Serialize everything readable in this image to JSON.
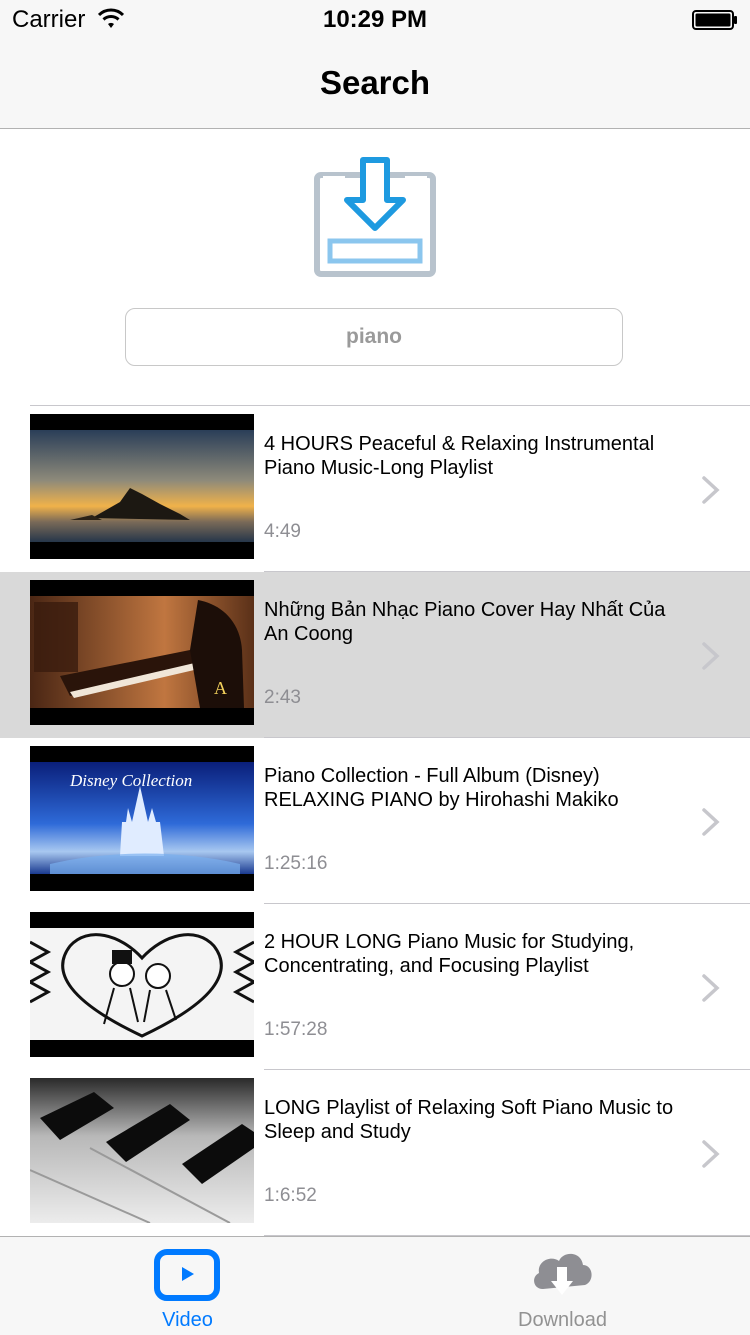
{
  "status_bar": {
    "carrier": "Carrier",
    "time": "10:29 PM"
  },
  "nav": {
    "title": "Search"
  },
  "search": {
    "value": "piano",
    "placeholder": "piano"
  },
  "results": [
    {
      "title": "4 HOURS Peaceful & Relaxing Instrumental Piano Music-Long Playlist",
      "duration": "4:49",
      "thumbnail": "sunset-sea-island",
      "selected": false
    },
    {
      "title": "Những Bản Nhạc Piano Cover Hay Nhất Của An Coong",
      "duration": "2:43",
      "thumbnail": "woman-playing-piano",
      "selected": true
    },
    {
      "title": "Piano Collection - Full Album (Disney) RELAXING PIANO by Hirohashi Makiko",
      "duration": "1:25:16",
      "thumbnail": "disney-collection-castle",
      "thumbnail_text": "Disney Collection",
      "selected": false
    },
    {
      "title": "2 HOUR LONG Piano Music for Studying, Concentrating, and Focusing Playlist",
      "duration": "1:57:28",
      "thumbnail": "cartoon-couple-heart",
      "selected": false
    },
    {
      "title": "LONG Playlist of Relaxing Soft Piano Music to Sleep and Study",
      "duration": "1:6:52",
      "thumbnail": "piano-keys-closeup",
      "selected": false
    }
  ],
  "tabs": [
    {
      "label": "Video",
      "icon": "video-play-icon",
      "active": true,
      "color": "#007aff"
    },
    {
      "label": "Download",
      "icon": "cloud-download-icon",
      "active": false,
      "color": "#929292"
    }
  ]
}
